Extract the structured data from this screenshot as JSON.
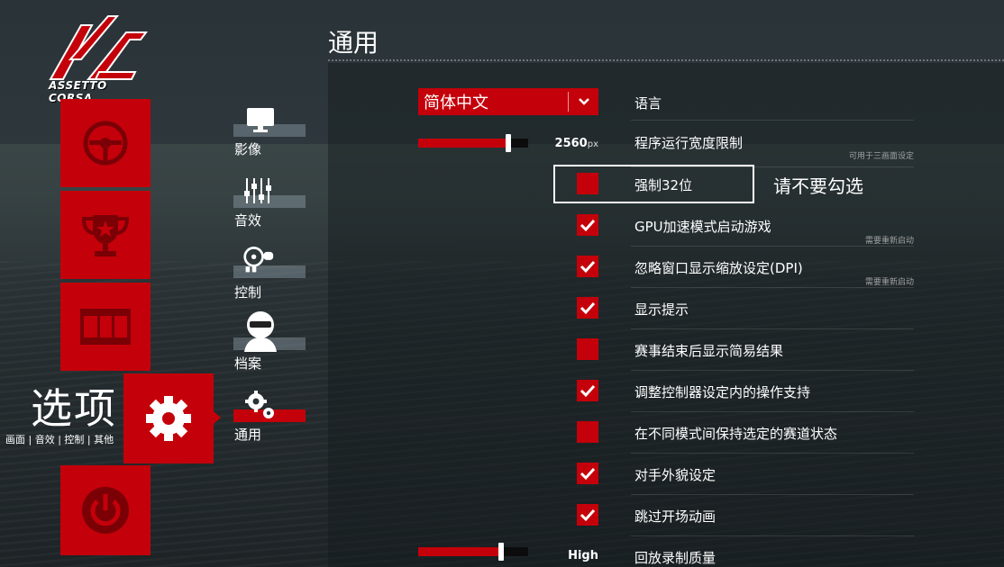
{
  "brand": {
    "name": "ASSETTO CORSA"
  },
  "colors": {
    "accent": "#c4000a",
    "text": "#ffffff"
  },
  "left_nav": {
    "tiles": [
      {
        "name": "drive",
        "icon": "steering-wheel-icon"
      },
      {
        "name": "results",
        "icon": "trophy-icon"
      },
      {
        "name": "replay",
        "icon": "film-strip-icon"
      },
      {
        "name": "options",
        "icon": "gear-icon",
        "active": true
      },
      {
        "name": "exit",
        "icon": "power-icon"
      }
    ],
    "section_title": "选项",
    "section_sub": "画面 | 音效 | 控制 | 其他"
  },
  "sub_nav": {
    "items": [
      {
        "label": "影像",
        "icon": "monitor-icon"
      },
      {
        "label": "音效",
        "icon": "equalizer-icon"
      },
      {
        "label": "控制",
        "icon": "controls-icon"
      },
      {
        "label": "档案",
        "icon": "driver-helmet-icon"
      },
      {
        "label": "通用",
        "icon": "gears-icon",
        "active": true
      }
    ]
  },
  "page": {
    "title": "通用"
  },
  "settings": {
    "language": {
      "label": "语言",
      "value": "简体中文"
    },
    "render_width": {
      "label": "程序运行宽度限制",
      "value": "2560",
      "unit": "px",
      "fraction": 0.82,
      "note": "可用于三画面设定"
    },
    "force_32bit": {
      "label": "强制32位",
      "checked": false
    },
    "gpu_accel": {
      "label": "GPU加速模式启动游戏",
      "checked": true,
      "note": "需要重新启动"
    },
    "ignore_dpi": {
      "label": "忽略窗口显示缩放设定(DPI)",
      "checked": true,
      "note": "需要重新启动"
    },
    "show_hints": {
      "label": "显示提示",
      "checked": true
    },
    "simple_results": {
      "label": "赛事结束后显示简易结果",
      "checked": false
    },
    "controller_support": {
      "label": "调整控制器设定内的操作支持",
      "checked": true
    },
    "keep_track_state": {
      "label": "在不同模式间保持选定的赛道状态",
      "checked": false
    },
    "opponent_skins": {
      "label": "对手外貌设定",
      "checked": true
    },
    "skip_intro": {
      "label": "跳过开场动画",
      "checked": true
    },
    "replay_quality": {
      "label": "回放录制质量",
      "value": "High",
      "fraction": 0.75
    }
  },
  "annotation": {
    "text": "请不要勾选"
  }
}
